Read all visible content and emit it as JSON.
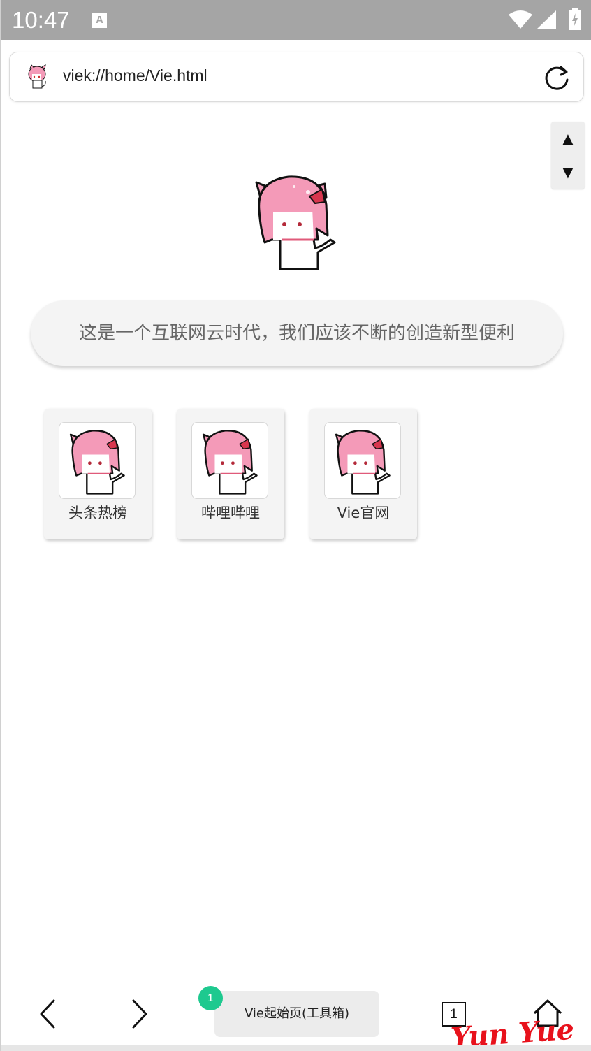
{
  "status_bar": {
    "time": "10:47",
    "notification_icon": "A"
  },
  "address_bar": {
    "url": "viek://home/Vie.html",
    "favicon": "mascot-icon",
    "reload_icon": "reload-icon"
  },
  "scroll_controls": {
    "up": "▲",
    "down": "▼"
  },
  "slogan": "这是一个互联网云时代，我们应该不断的创造新型便利",
  "shortcuts": [
    {
      "label": "头条热榜"
    },
    {
      "label": "哔哩哔哩"
    },
    {
      "label": "Vie官网"
    }
  ],
  "bottom_nav": {
    "back_icon": "chevron-left-icon",
    "forward_icon": "chevron-right-icon",
    "current_tab_title": "Vie起始页(工具箱)",
    "tab_badge": "1",
    "tab_count": "1",
    "home_icon": "home-icon"
  },
  "watermark": "Yun Yue",
  "colors": {
    "status_bar": "#a5a5a5",
    "badge": "#1ec98f",
    "watermark": "#e8121c",
    "mascot_hair": "#f49ab8",
    "mascot_bow": "#d8364e"
  }
}
